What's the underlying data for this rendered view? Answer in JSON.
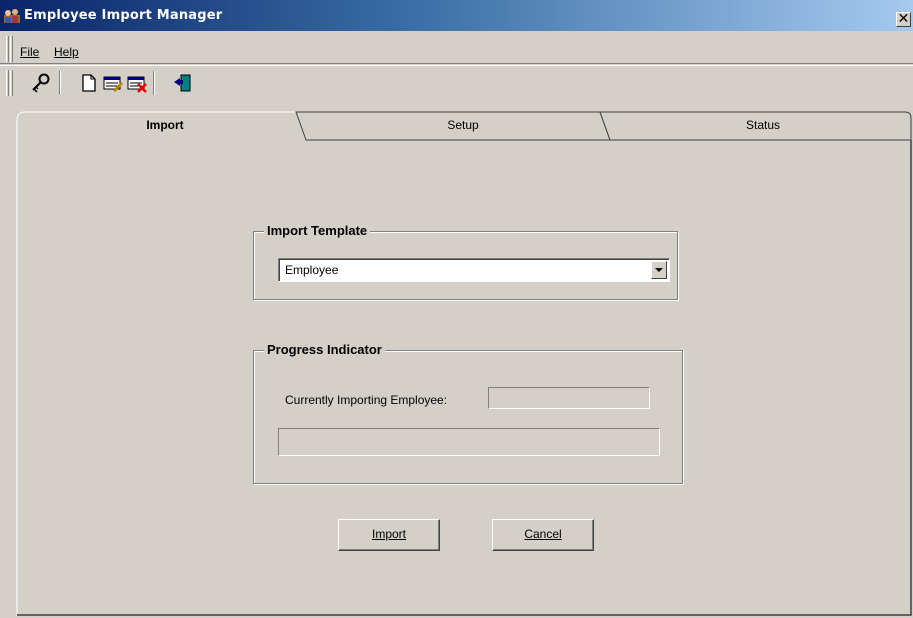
{
  "window": {
    "title": "Employee Import Manager",
    "close_glyph": "✕"
  },
  "menu": {
    "file_label": "File",
    "help_label": "Help"
  },
  "toolbar": {
    "icons": [
      "key-icon",
      "new-document-icon",
      "edit-record-icon",
      "delete-record-icon",
      "exit-door-icon"
    ]
  },
  "tabs": [
    {
      "label": "Import",
      "selected": true
    },
    {
      "label": "Setup",
      "selected": false
    },
    {
      "label": "Status",
      "selected": false
    }
  ],
  "import_template": {
    "group_label": "Import Template",
    "selected_value": "Employee"
  },
  "progress": {
    "group_label": "Progress Indicator",
    "current_label": "Currently Importing Employee:",
    "current_value": "",
    "progress_fraction": 0
  },
  "buttons": {
    "import_label": "Import",
    "cancel_label": "Cancel"
  },
  "colors": {
    "title_gradient_start": "#0a246a",
    "title_gradient_end": "#a6caf0",
    "face": "#d4d0c8"
  }
}
